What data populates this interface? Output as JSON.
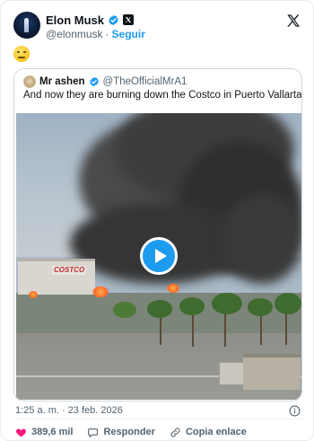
{
  "post": {
    "author": {
      "display_name": "Elon Musk",
      "handle": "@elonmusk",
      "follow_label": "Seguir",
      "separator": "·"
    },
    "body_emoji": "neutral-face-emoji",
    "quoted": {
      "display_name": "Mr ashen",
      "handle": "@TheOfficialMrA1",
      "text": "And now they are burning down the Costco in Puerto Vallarta. #Mexico",
      "media": {
        "type": "video",
        "store_sign": "COSTCO"
      }
    },
    "timestamp": "1:25 a. m. · 23 feb. 2026",
    "actions": {
      "like_count": "389,6 mil",
      "reply_label": "Responder",
      "copy_link_label": "Copia enlace"
    }
  },
  "icons": {
    "verified": "verified-badge-icon",
    "x_logo": "x-logo-icon",
    "info": "info-icon",
    "heart": "heart-icon",
    "reply": "reply-icon",
    "link": "link-icon",
    "play": "play-icon"
  },
  "colors": {
    "accent": "#1d9bf0",
    "like": "#f91880",
    "text": "#0f1419",
    "muted": "#536471"
  }
}
